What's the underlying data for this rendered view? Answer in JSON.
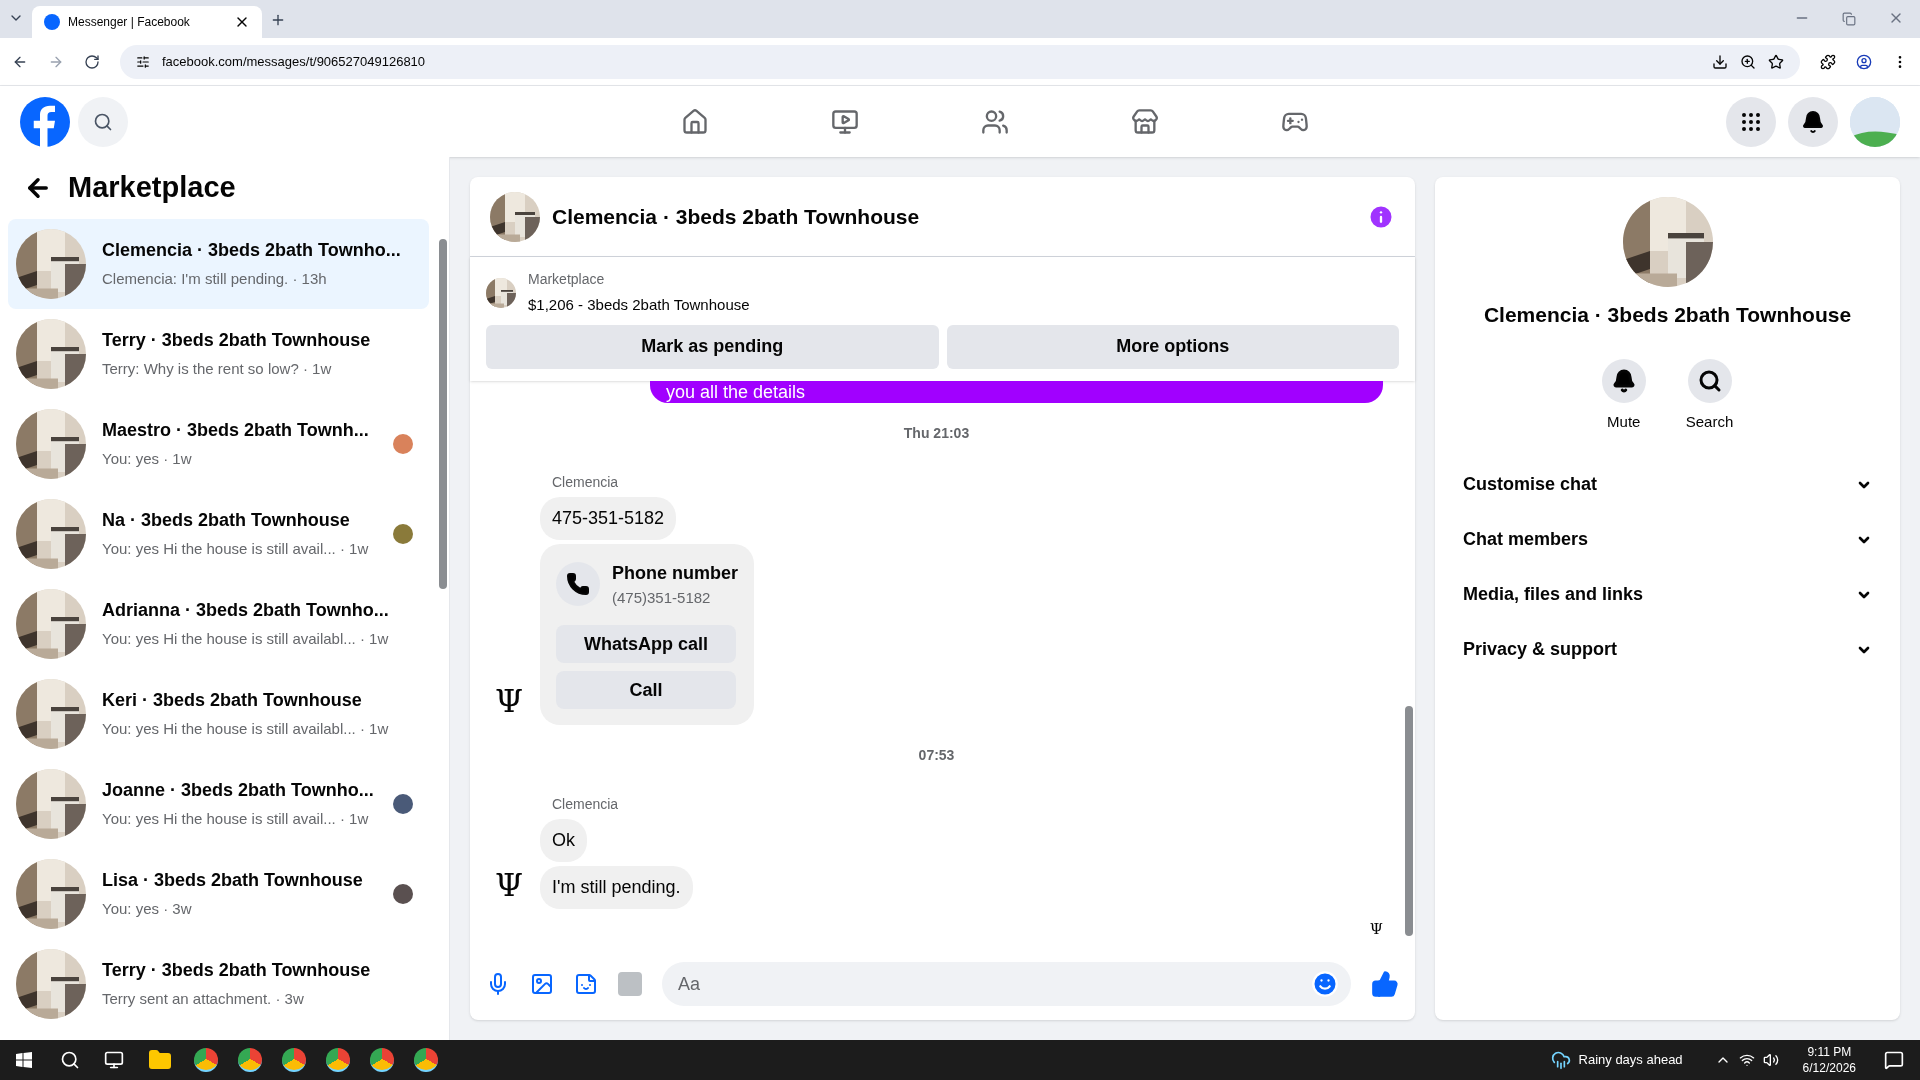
{
  "browser": {
    "tab_title": "Messenger | Facebook",
    "url": "facebook.com/messages/t/906527049126810"
  },
  "nav": [
    {
      "kind": "home",
      "selected": false
    },
    {
      "kind": "video",
      "selected": false
    },
    {
      "kind": "friends",
      "selected": false
    },
    {
      "kind": "store",
      "selected": false
    },
    {
      "kind": "gaming",
      "selected": false
    }
  ],
  "sidebar": {
    "title": "Marketplace",
    "conversations": [
      {
        "title": "Clemencia · 3beds 2bath Townho...",
        "preview": "Clemencia: I'm still pending. · 13h",
        "selected": true,
        "read_receipt": false
      },
      {
        "title": "Terry · 3beds 2bath Townhouse",
        "preview": "Terry: Why is the rent so low? · 1w",
        "selected": false,
        "read_receipt": false
      },
      {
        "title": "Maestro · 3beds 2bath Townh...",
        "preview": "You: yes · 1w",
        "selected": false,
        "read_receipt": true,
        "color": "#d9825b"
      },
      {
        "title": "Na · 3beds 2bath Townhouse",
        "preview": "You: yes Hi the house is still avail... · 1w",
        "selected": false,
        "read_receipt": true,
        "color": "#8a7a3a"
      },
      {
        "title": "Adrianna · 3beds 2bath Townho...",
        "preview": "You: yes Hi the house is still availabl... · 1w",
        "selected": false,
        "read_receipt": false
      },
      {
        "title": "Keri · 3beds 2bath Townhouse",
        "preview": "You: yes Hi the house is still availabl... · 1w",
        "selected": false,
        "read_receipt": false
      },
      {
        "title": "Joanne · 3beds 2bath Townho...",
        "preview": "You: yes Hi the house is still avail... · 1w",
        "selected": false,
        "read_receipt": true,
        "color": "#4a5a78"
      },
      {
        "title": "Lisa · 3beds 2bath Townhouse",
        "preview": "You: yes · 3w",
        "selected": false,
        "read_receipt": true,
        "color": "#5a5050"
      },
      {
        "title": "Terry · 3beds 2bath Townhouse",
        "preview": "Terry sent an attachment. · 3w",
        "selected": false,
        "read_receipt": false
      }
    ]
  },
  "chat": {
    "title": "Clemencia · 3beds 2bath Townhouse",
    "listing_label": "Marketplace",
    "listing": "$1,206 - 3beds 2bath Townhouse",
    "actions": [
      "Mark as pending",
      "More options"
    ],
    "messages": [
      {
        "kind": "outgoing",
        "text": "you all the details"
      },
      {
        "kind": "time",
        "text": "Thu 21:03"
      },
      {
        "kind": "incoming",
        "sender": "Clemencia",
        "avatar": "Ψ",
        "bubbles": [
          {
            "kind": "text",
            "text": "475-351-5182"
          },
          {
            "kind": "phone",
            "title": "Phone number",
            "number": "(475)351-5182",
            "buttons": [
              "WhatsApp call",
              "Call"
            ]
          }
        ]
      },
      {
        "kind": "time",
        "text": "07:53"
      },
      {
        "kind": "incoming",
        "sender": "Clemencia",
        "avatar": "Ψ",
        "bubbles": [
          {
            "kind": "text",
            "text": "Ok"
          },
          {
            "kind": "text",
            "text": "I'm still pending."
          }
        ]
      }
    ],
    "seen": "Ψ",
    "composer": {
      "placeholder": "Aa"
    }
  },
  "details": {
    "title": "Clemencia · 3beds 2bath Townhouse",
    "actions": [
      {
        "kind": "mute",
        "label": "Mute"
      },
      {
        "kind": "search",
        "label": "Search"
      }
    ],
    "sections": [
      {
        "label": "Customise chat",
        "expanded": false
      },
      {
        "label": "Chat members",
        "expanded": false
      },
      {
        "label": "Media, files and links",
        "expanded": false
      },
      {
        "label": "Privacy & support",
        "expanded": false
      }
    ]
  },
  "taskbar": {
    "weather": "Rainy days ahead",
    "time": "9:11 PM",
    "date": "6/12/2026"
  }
}
